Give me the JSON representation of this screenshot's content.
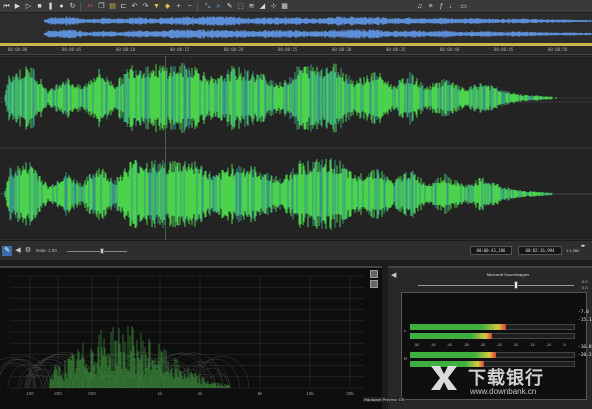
{
  "toolbar": {
    "buttons": [
      "rewind",
      "play",
      "play-all",
      "stop",
      "pause",
      "record",
      "loop",
      "cut",
      "copy",
      "paste",
      "trim",
      "undo",
      "redo",
      "mark",
      "region",
      "zoom-in",
      "zoom-out",
      "edit-tool",
      "magnify-tool",
      "pencil-tool",
      "select",
      "normalize",
      "fade",
      "marker",
      "snap",
      "grid"
    ]
  },
  "ruler": {
    "labels": [
      "00:00:00",
      "00:00:05",
      "00:00:10",
      "00:00:15",
      "00:00:20",
      "00:00:25",
      "00:00:30",
      "00:00:35",
      "00:00:40",
      "00:00:45",
      "00:00:50"
    ]
  },
  "status": {
    "rate_label": "Rate: 1.00",
    "rate_value": 0.58,
    "time_cursor": "00:00:43,286",
    "time_length": "00:02:16,994",
    "zoom": "1:1,980"
  },
  "spectrum": {
    "freq_labels": [
      "100",
      "200",
      "500",
      "1k",
      "2k",
      "5k",
      "10k",
      "20k"
    ]
  },
  "meter": {
    "device_title": "Microsoft Soundmapper",
    "volume_level": 0.63,
    "volume_top": "0.0",
    "volume_bottom": "0.0",
    "left_label": "L",
    "right_label": "R",
    "left_peak": "-7.0",
    "left_rms": "-15.1",
    "right_peak": "-16.8",
    "right_rms": "-20.2",
    "scale": [
      "-50",
      "-45",
      "-40",
      "-35",
      "-30",
      "-25",
      "-20",
      "-15",
      "-10",
      "-5"
    ],
    "left_level": 0.58,
    "right_level": 0.52,
    "colors": {
      "green": "#3fb03f",
      "yellow": "#d8c840",
      "red": "#d84040"
    }
  },
  "hw_label": "Hardware Preview: DS",
  "watermark": {
    "name": "下载银行",
    "url": "www.downbank.cn"
  },
  "colors": {
    "wave_green": "#4cd34c",
    "wave_teal": "#3fb0a0",
    "overview_blue": "#5d8fd8",
    "background": "#232323"
  }
}
